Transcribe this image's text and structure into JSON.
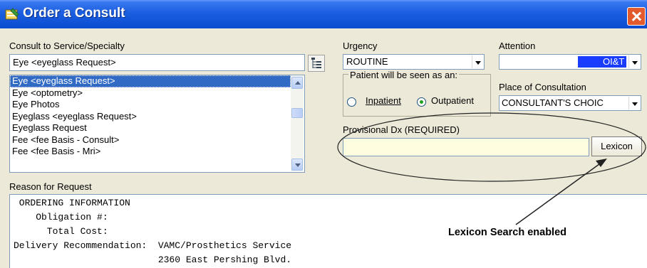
{
  "window": {
    "title": "Order a Consult",
    "title_icon": "order-form-icon",
    "close_icon": "close-icon"
  },
  "service": {
    "label": "Consult to Service/Specialty",
    "value": "Eye  <eyeglass Request>",
    "tree_icon": "tree-view-icon",
    "list": [
      {
        "text": "Eye  <eyeglass Request>",
        "selected": true
      },
      {
        "text": "Eye  <optometry>",
        "selected": false
      },
      {
        "text": "Eye Photos",
        "selected": false
      },
      {
        "text": "Eyeglass  <eyeglass Request>",
        "selected": false
      },
      {
        "text": "Eyeglass Request",
        "selected": false
      },
      {
        "text": "Fee  <fee Basis - Consult>",
        "selected": false
      },
      {
        "text": "Fee  <fee Basis - Mri>",
        "selected": false
      }
    ]
  },
  "urgency": {
    "label": "Urgency",
    "value": "ROUTINE"
  },
  "patient_seen": {
    "legend": "Patient will be seen as an:",
    "inpatient_label": "Inpatient",
    "outpatient_label": "Outpatient",
    "selected": "Outpatient"
  },
  "attention": {
    "label": "Attention",
    "value": "OI&T S"
  },
  "place": {
    "label": "Place of Consultation",
    "value": "CONSULTANT'S CHOIC"
  },
  "provisional_dx": {
    "label": "Provisional Dx (REQUIRED)",
    "value": "",
    "lexicon_button": "Lexicon"
  },
  "reason": {
    "label": "Reason for Request",
    "lines": [
      " ORDERING INFORMATION",
      "    Obligation #:",
      "      Total Cost:",
      "Delivery Recommendation:  VAMC/Prosthetics Service",
      "                          2360 East Pershing Blvd."
    ]
  },
  "annotation": {
    "text": "Lexicon Search enabled"
  },
  "colors": {
    "titlebar": "#0a4bd0",
    "selection": "#316ac5",
    "dx_field": "#fffde0",
    "window_bg": "#ece9d8"
  }
}
